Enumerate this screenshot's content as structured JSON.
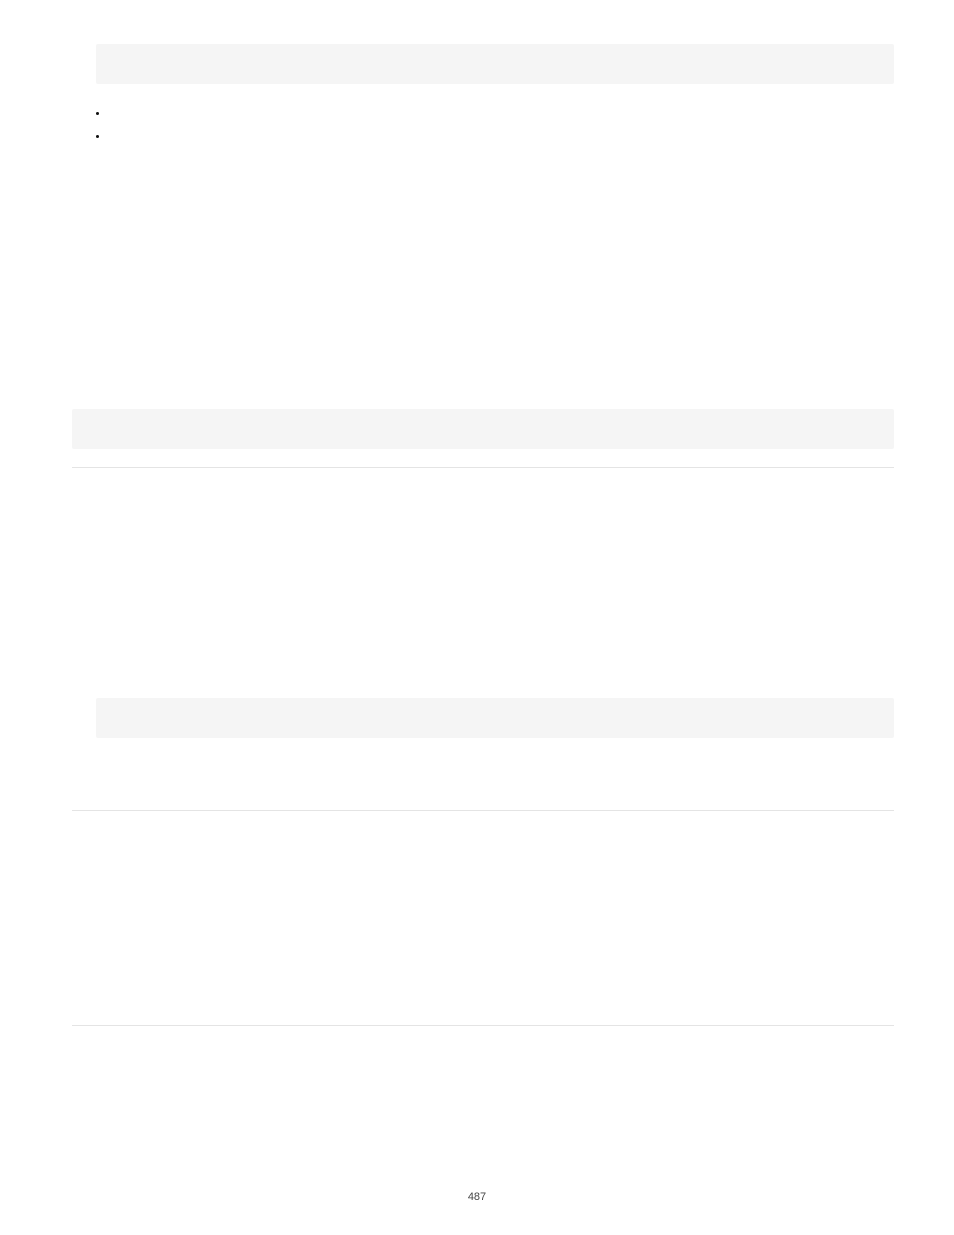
{
  "bullets": {
    "items": [
      {
        "label": ""
      },
      {
        "label": ""
      }
    ]
  },
  "page_number": "487"
}
